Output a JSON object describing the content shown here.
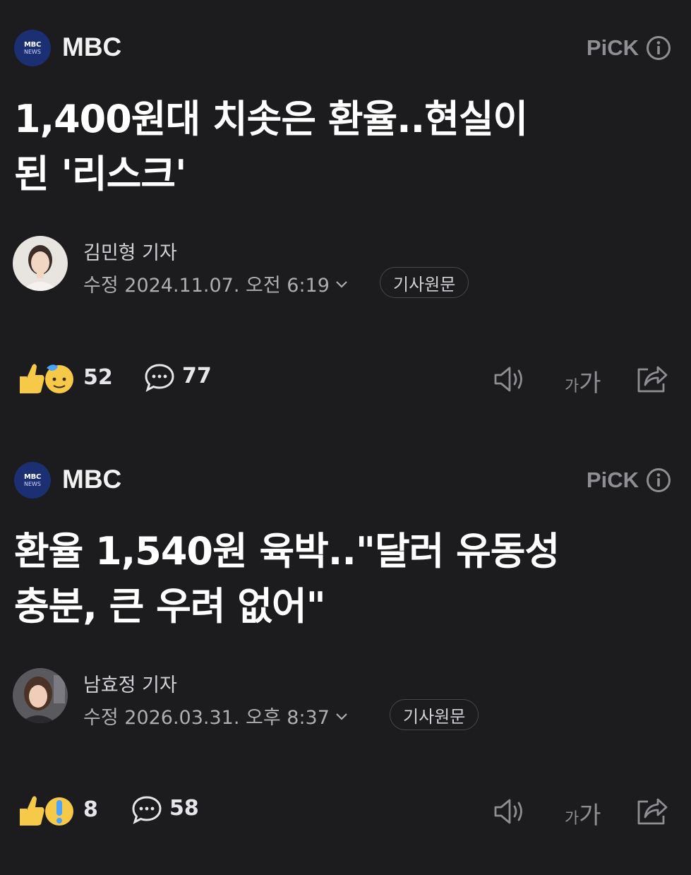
{
  "articles": [
    {
      "press": {
        "name": "MBC",
        "logo_top": "MBC",
        "logo_bottom": "NEWS"
      },
      "pick_label": "PiCK",
      "info_icon": "info-icon",
      "title_line1": "1,400원대 치솟은 환율..현실이",
      "title_line2": "된 '리스크'",
      "reporter": "김민형 기자",
      "timestamp": "수정 2024.11.07. 오전 6:19",
      "original_label": "기사원문",
      "reaction_count": "52",
      "comment_count": "77",
      "font_size_small": "가",
      "font_size_big": "가"
    },
    {
      "press": {
        "name": "MBC",
        "logo_top": "MBC",
        "logo_bottom": "NEWS"
      },
      "pick_label": "PiCK",
      "info_icon": "info-icon",
      "title_line1": "환율 1,540원 육박..\"달러 유동성",
      "title_line2": "충분, 큰 우려 없어\"",
      "reporter": "남효정 기자",
      "timestamp": "수정 2026.03.31. 오후 8:37",
      "original_label": "기사원문",
      "reaction_count": "8",
      "comment_count": "58",
      "font_size_small": "가",
      "font_size_big": "가"
    }
  ],
  "colors": {
    "background": "#1c1c1e",
    "text_primary": "#ffffff",
    "text_secondary": "#aeaeb2",
    "press_logo": "#1d2f73",
    "emoji_yellow": "#f7c948",
    "emoji_blue": "#4aa3ff"
  }
}
